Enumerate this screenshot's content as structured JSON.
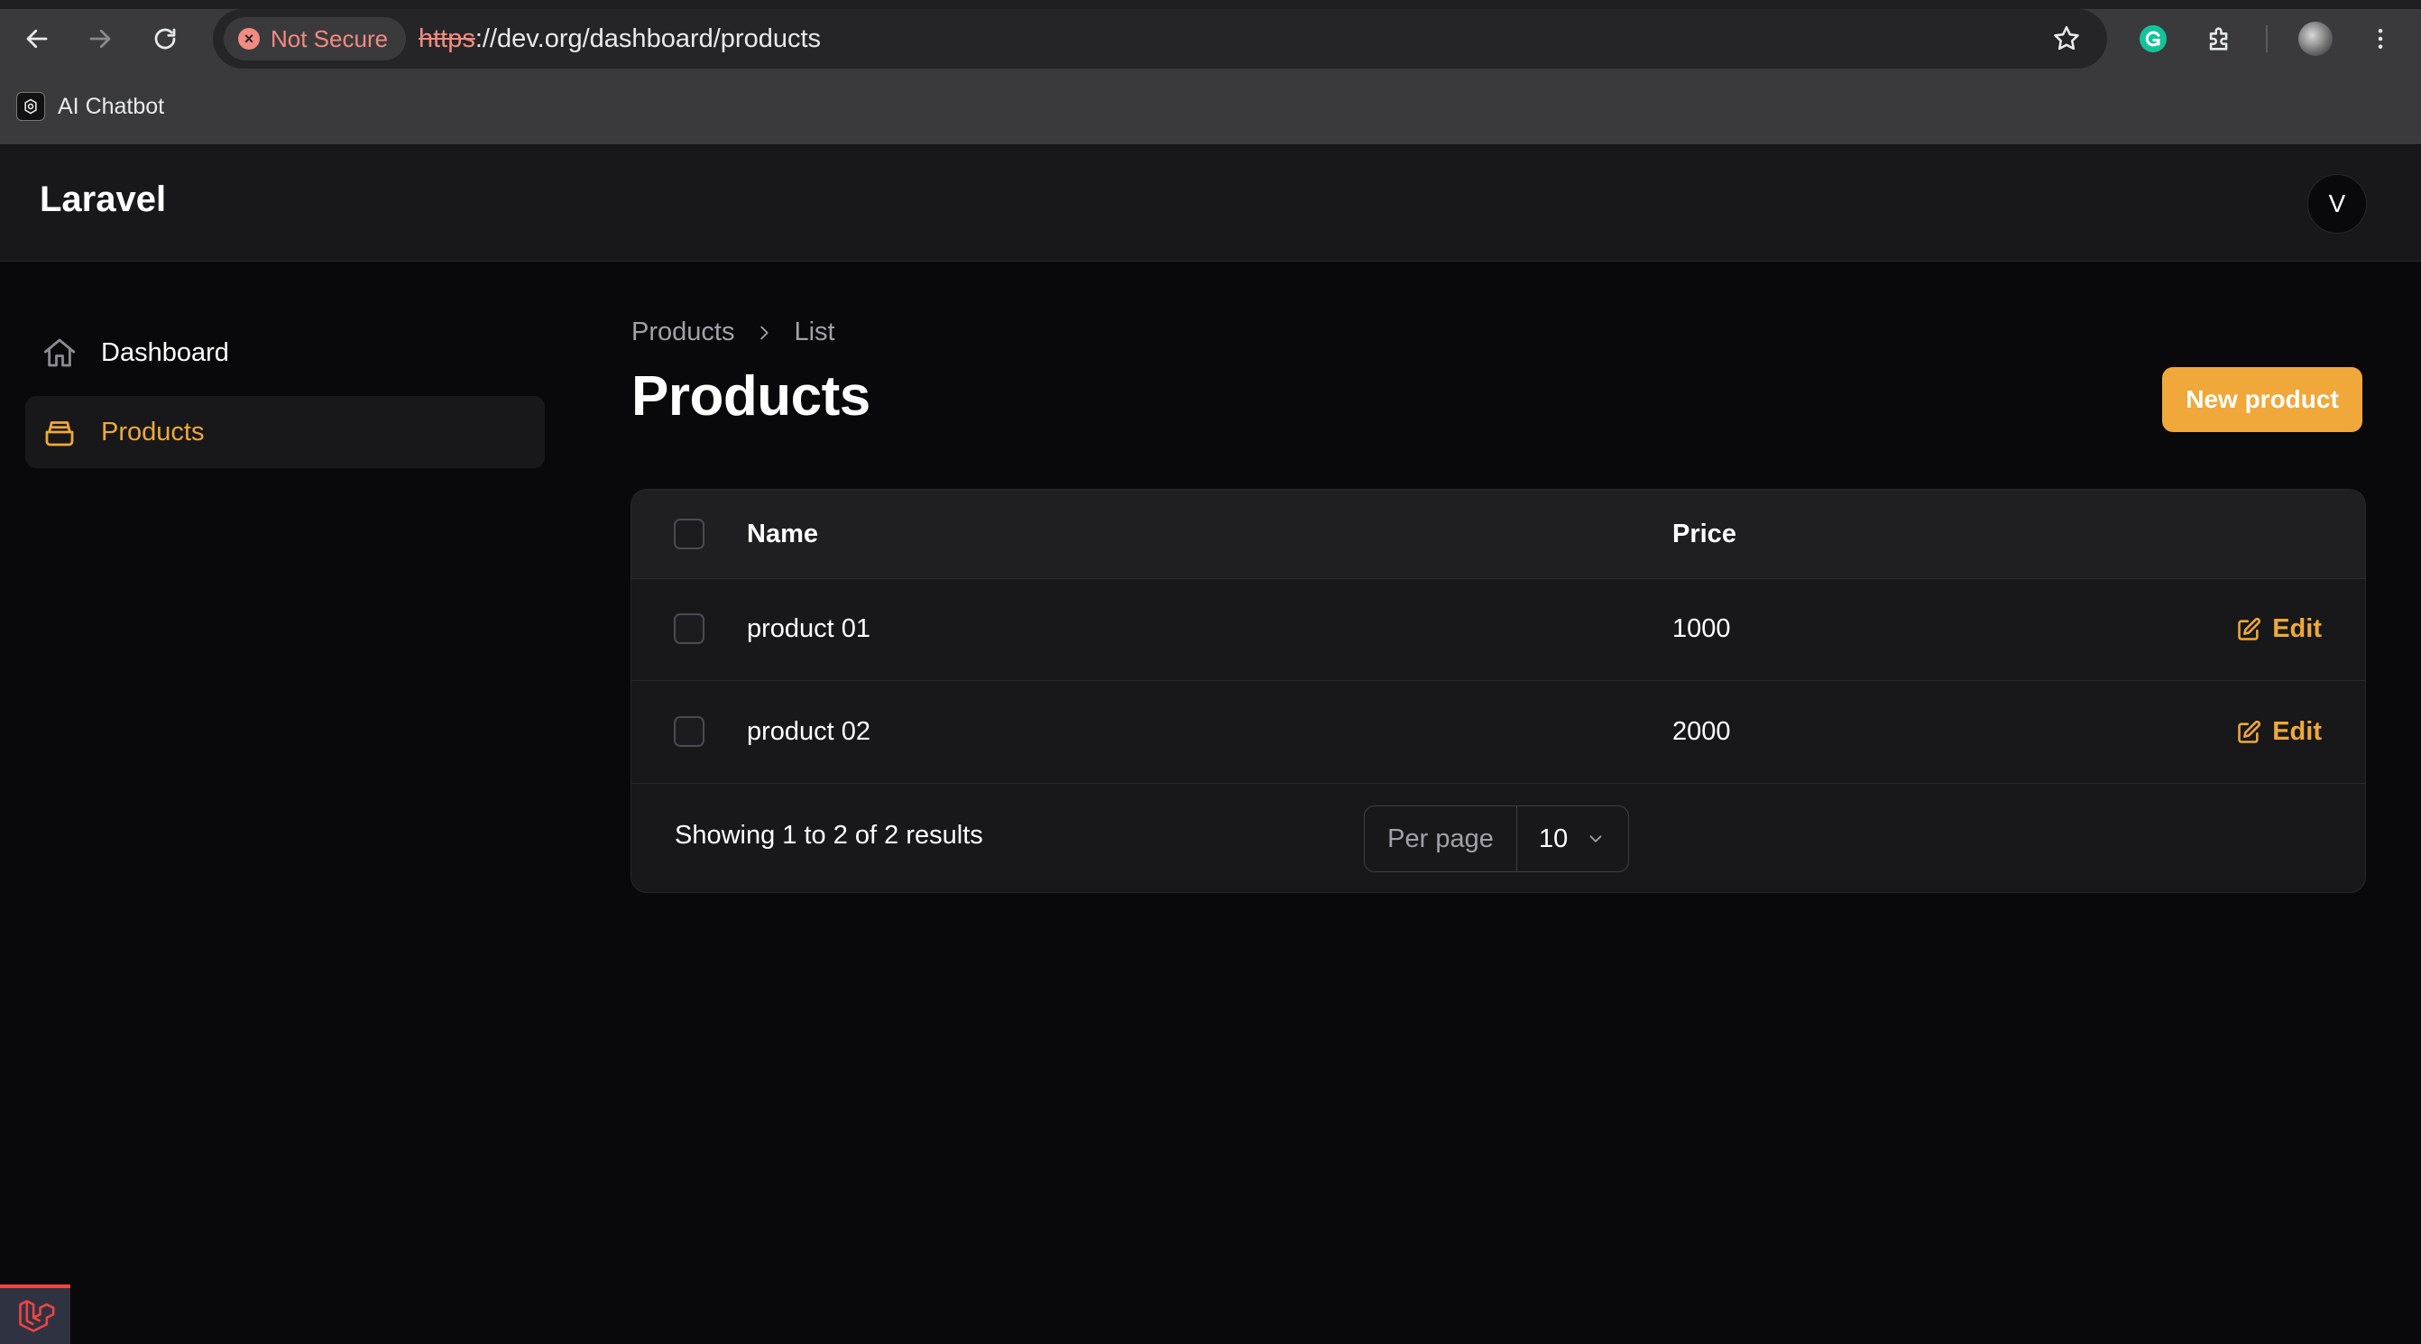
{
  "browser": {
    "security_label": "Not Secure",
    "url_scheme": "https",
    "url_rest": "://dev.org/dashboard/products",
    "bookmark_label": "AI Chatbot"
  },
  "header": {
    "brand": "Laravel",
    "avatar_initial": "V"
  },
  "sidebar": {
    "items": [
      {
        "label": "Dashboard",
        "icon": "home-icon",
        "active": false
      },
      {
        "label": "Products",
        "icon": "inbox-icon",
        "active": true
      }
    ]
  },
  "main": {
    "breadcrumb": [
      "Products",
      "List"
    ],
    "title": "Products",
    "new_button": "New product",
    "accent": "#f0a83a"
  },
  "table": {
    "columns": [
      "Name",
      "Price"
    ],
    "rows": [
      {
        "name": "product 01",
        "price": "1000",
        "action": "Edit"
      },
      {
        "name": "product 02",
        "price": "2000",
        "action": "Edit"
      }
    ],
    "summary": "Showing 1 to 2 of 2 results",
    "per_page_label": "Per page",
    "per_page_value": "10"
  }
}
